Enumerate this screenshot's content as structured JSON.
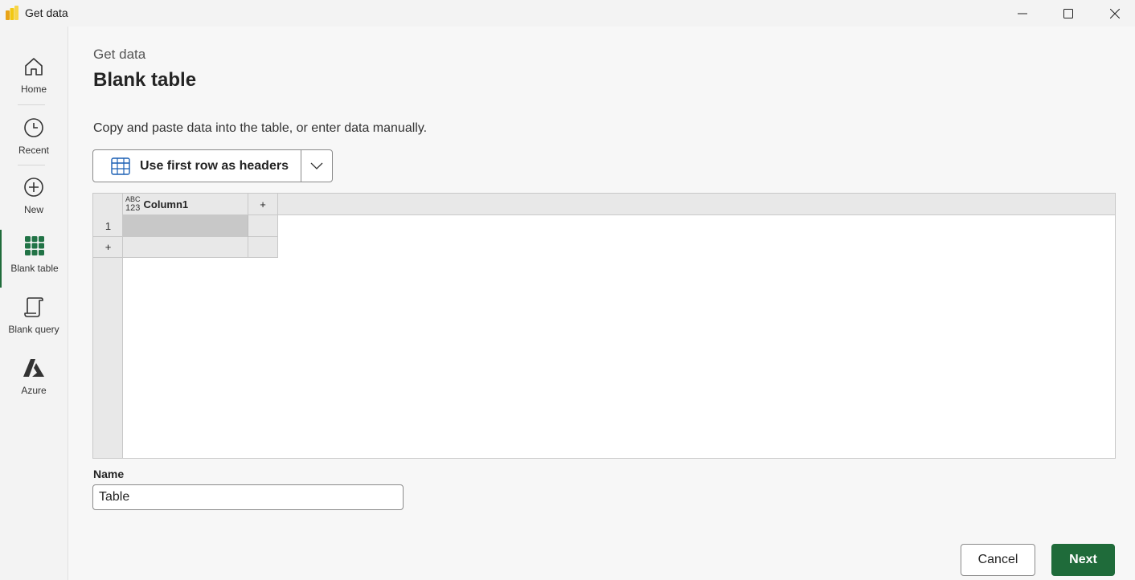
{
  "window": {
    "title": "Get data",
    "icon": "power-bi-icon",
    "controls": [
      "minimize-icon",
      "maximize-icon",
      "close-icon"
    ]
  },
  "rail": {
    "items": [
      {
        "label": "Home",
        "icon": "home-icon"
      },
      {
        "label": "Recent",
        "icon": "clock-icon"
      },
      {
        "label": "New",
        "icon": "plus-circle-icon"
      },
      {
        "label": "Blank table",
        "icon": "table-grid-icon",
        "active": true
      },
      {
        "label": "Blank query",
        "icon": "script-icon"
      },
      {
        "label": "Azure",
        "icon": "azure-icon"
      }
    ]
  },
  "main": {
    "breadcrumb": "Get data",
    "title": "Blank table",
    "description": "Copy and paste data into the table, or enter data manually.",
    "header_button_label": "Use first row as headers"
  },
  "grid": {
    "columns": [
      {
        "type_badge_top": "ABC",
        "type_badge_bottom": "123",
        "name": "Column1"
      }
    ],
    "add_column_label": "+",
    "rows": [
      {
        "number": "1",
        "cells": [
          ""
        ]
      }
    ],
    "add_row_label": "+"
  },
  "name_field": {
    "label": "Name",
    "value": "Table"
  },
  "footer": {
    "cancel_label": "Cancel",
    "next_label": "Next"
  },
  "colors": {
    "accent": "#1f6b3a",
    "icon_green": "#217346"
  }
}
